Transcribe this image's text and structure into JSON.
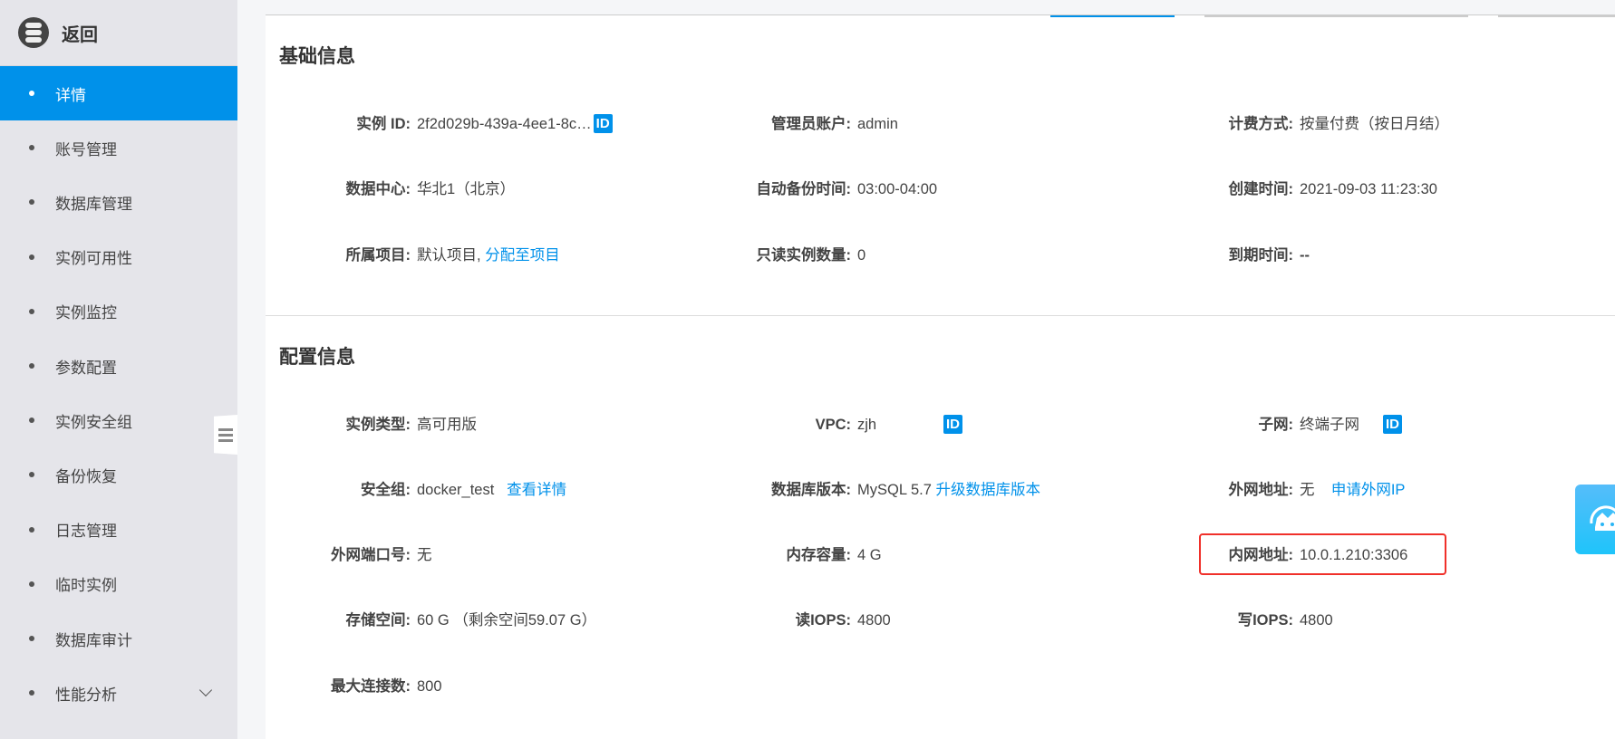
{
  "sidebar": {
    "back_label": "返回",
    "items": [
      {
        "label": "详情"
      },
      {
        "label": "账号管理"
      },
      {
        "label": "数据库管理"
      },
      {
        "label": "实例可用性"
      },
      {
        "label": "实例监控"
      },
      {
        "label": "参数配置"
      },
      {
        "label": "实例安全组"
      },
      {
        "label": "备份恢复"
      },
      {
        "label": "日志管理"
      },
      {
        "label": "临时实例"
      },
      {
        "label": "数据库审计"
      },
      {
        "label": "性能分析"
      }
    ],
    "active_index": 0
  },
  "basic": {
    "title": "基础信息",
    "instance_id": {
      "label": "实例 ID:",
      "value": "2f2d029b-439a-4ee1-8c…",
      "badge": "ID"
    },
    "admin": {
      "label": "管理员账户:",
      "value": "admin"
    },
    "billing": {
      "label": "计费方式:",
      "value": "按量付费（按日月结）"
    },
    "datacenter": {
      "label": "数据中心:",
      "value": "华北1（北京）"
    },
    "backup_time": {
      "label": "自动备份时间:",
      "value": "03:00-04:00"
    },
    "created": {
      "label": "创建时间:",
      "value": "2021-09-03 11:23:30"
    },
    "project": {
      "label": "所属项目:",
      "value": "默认项目,",
      "link": "分配至项目"
    },
    "readonly_count": {
      "label": "只读实例数量:",
      "value": "0"
    },
    "expire": {
      "label": "到期时间:",
      "value": "--"
    }
  },
  "config": {
    "title": "配置信息",
    "type": {
      "label": "实例类型:",
      "value": "高可用版"
    },
    "vpc": {
      "label": "VPC:",
      "value": "zjh",
      "badge": "ID"
    },
    "subnet": {
      "label": "子网:",
      "value": "终端子网",
      "badge": "ID"
    },
    "security_group": {
      "label": "安全组:",
      "value": "docker_test",
      "link": "查看详情"
    },
    "db_version": {
      "label": "数据库版本:",
      "value": "MySQL 5.7",
      "link": "升级数据库版本"
    },
    "public_ip": {
      "label": "外网地址:",
      "value": "无",
      "link": "申请外网IP"
    },
    "public_port": {
      "label": "外网端口号:",
      "value": "无"
    },
    "memory": {
      "label": "内存容量:",
      "value": "4 G"
    },
    "private_ip": {
      "label": "内网地址:",
      "value": "10.0.1.210:3306"
    },
    "storage": {
      "label": "存储空间:",
      "value": "60 G （剩余空间59.07 G）"
    },
    "read_iops": {
      "label": "读IOPS:",
      "value": "4800"
    },
    "write_iops": {
      "label": "写IOPS:",
      "value": "4800"
    },
    "max_conn": {
      "label": "最大连接数:",
      "value": "800"
    }
  },
  "colors": {
    "accent": "#0091ea",
    "highlight": "#f0302a"
  }
}
